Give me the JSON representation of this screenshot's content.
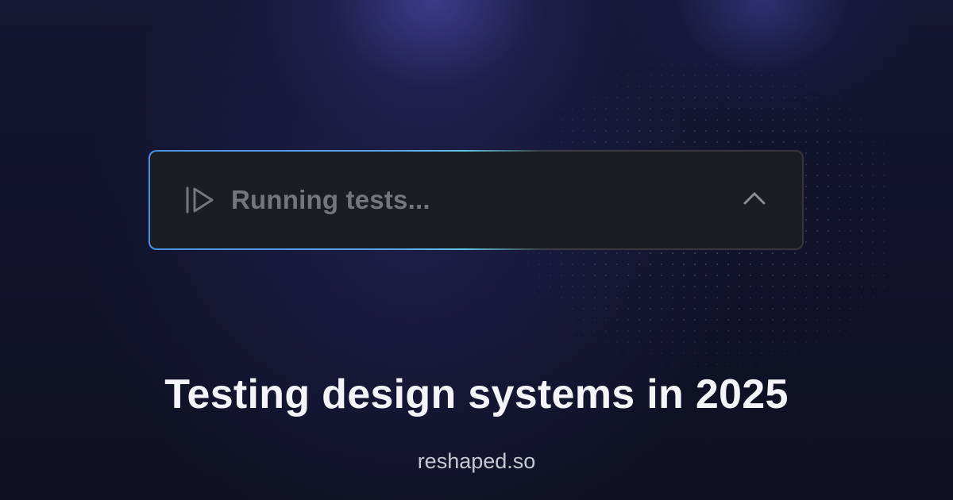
{
  "status": {
    "icon": "play-run-icon",
    "text": "Running tests...",
    "toggle_icon": "chevron-up-icon"
  },
  "headline": "Testing design systems in 2025",
  "site": "reshaped.so",
  "colors": {
    "background": "#0e1221",
    "glow": "#5c54c8",
    "bar_background": "#1c1d20",
    "bar_border_accent": "#4a90e2",
    "bar_text": "#73767d",
    "headline": "#f4f5f8",
    "site": "#c6c9d2"
  }
}
